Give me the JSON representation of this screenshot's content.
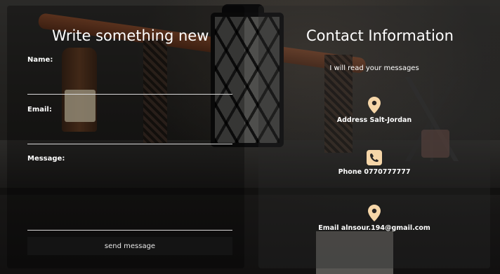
{
  "form": {
    "title": "Write something new",
    "name_label": "Name:",
    "email_label": "Email:",
    "message_label": "Message:",
    "name_value": "",
    "email_value": "",
    "message_value": "",
    "send_label": "send message"
  },
  "contact": {
    "title": "Contact Information",
    "subtitle": "I will read your messages",
    "address": "Address Salt-Jordan",
    "phone": "Phone 0770777777",
    "email": "Email alnsour.194@gmail.com",
    "icons": {
      "address": "map-pin-icon",
      "phone": "phone-icon",
      "email": "map-pin-icon"
    }
  },
  "colors": {
    "accent": "#f6d6a8",
    "text": "#ffffff",
    "button_bg": "#141414"
  }
}
